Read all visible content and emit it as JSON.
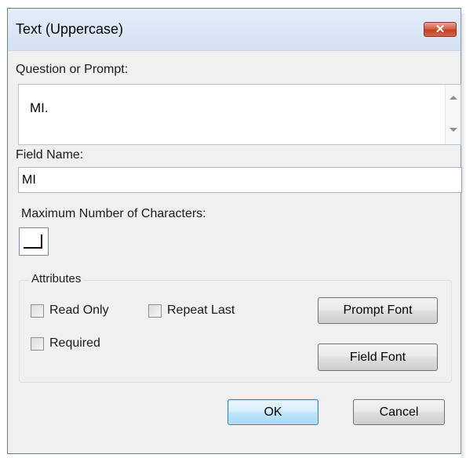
{
  "window": {
    "title": "Text (Uppercase)",
    "close_label": "✕"
  },
  "prompt": {
    "label": "Question or Prompt:",
    "value": "MI."
  },
  "field_name": {
    "label": "Field Name:",
    "value": "MI"
  },
  "max_chars": {
    "label": "Maximum Number of Characters:",
    "value": ""
  },
  "attributes": {
    "title": "Attributes",
    "read_only": {
      "label": "Read Only",
      "checked": false
    },
    "repeat_last": {
      "label": "Repeat Last",
      "checked": false
    },
    "required": {
      "label": "Required",
      "checked": false
    },
    "prompt_font_label": "Prompt Font",
    "field_font_label": "Field Font"
  },
  "actions": {
    "ok_label": "OK",
    "cancel_label": "Cancel"
  },
  "colors": {
    "window_bg": "#f0f0f0",
    "titlebar_bg": "#dce8f6",
    "close_button": "#c94a2b",
    "default_button_border": "#3c7fb1"
  },
  "icons": {
    "close": "close-icon",
    "scroll_up": "scroll-up-arrow-icon",
    "scroll_down": "scroll-down-arrow-icon"
  }
}
